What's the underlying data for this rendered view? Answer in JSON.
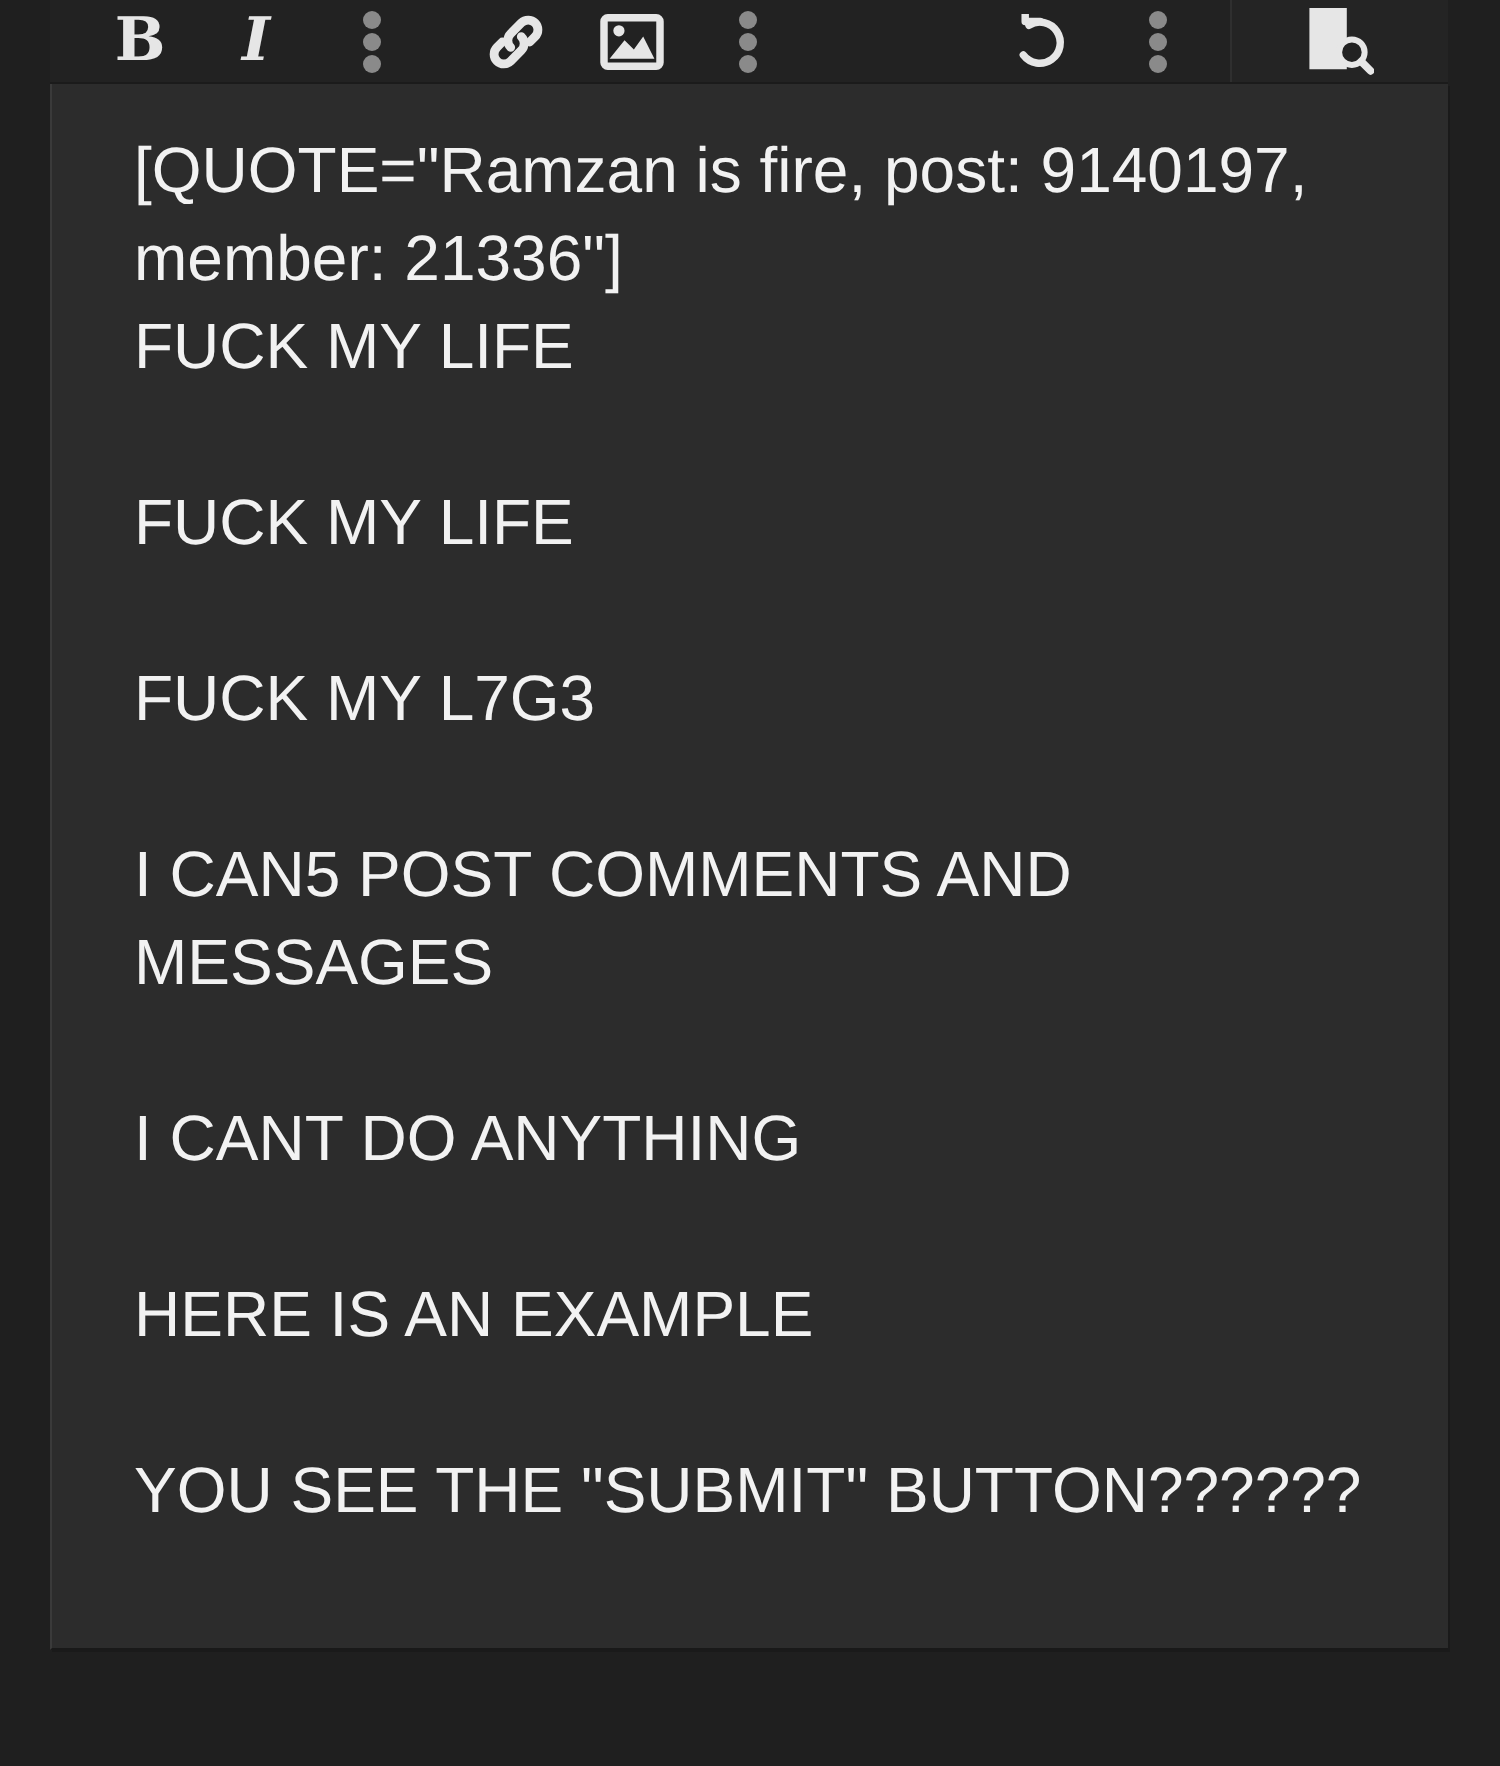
{
  "toolbar": {
    "bold_label": "B",
    "italic_label": "I"
  },
  "editor": {
    "value": "[QUOTE=\"Ramzan is fire, post: 9140197, member: 21336\"]\nFUCK MY LIFE\n\nFUCK MY LIFE\n\nFUCK MY L7G3\n\nI CAN5 POST COMMENTS AND MESSAGES\n\nI CANT DO ANYTHING\n\nHERE IS AN EXAMPLE\n\nYOU SEE THE \"SUBMIT\" BUTTON??????"
  }
}
